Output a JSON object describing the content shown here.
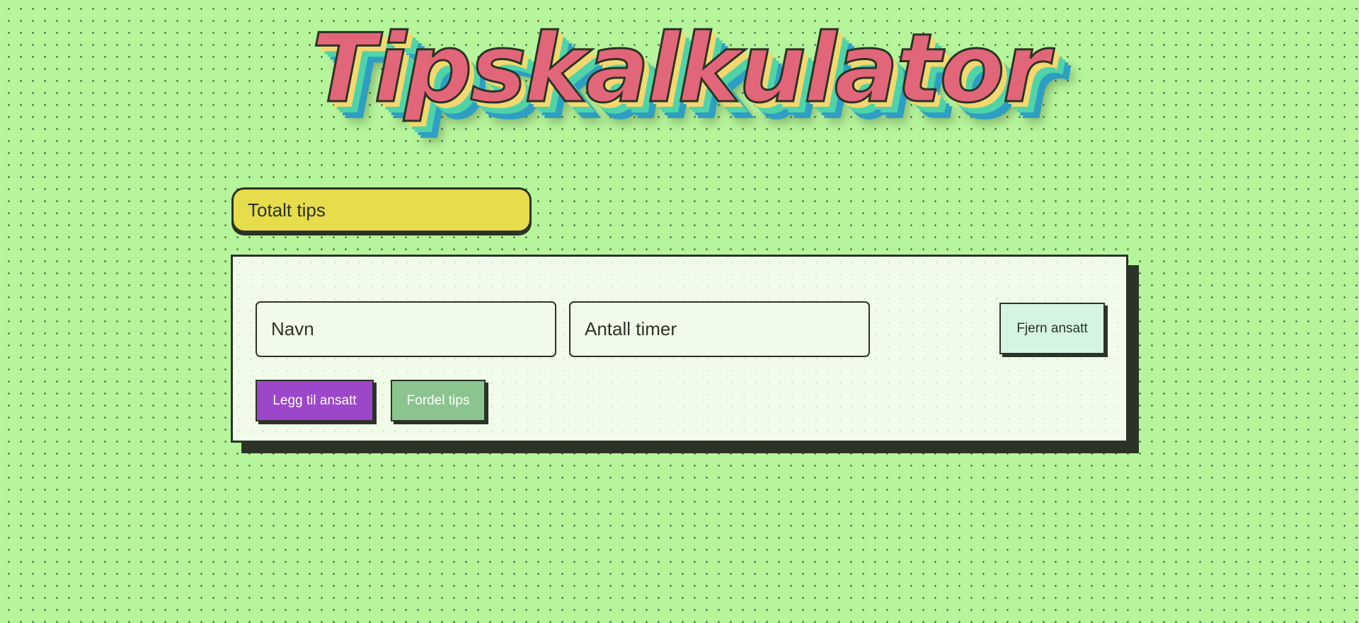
{
  "header": {
    "title": "Tipskalkulator"
  },
  "total_tips": {
    "placeholder": "Totalt tips",
    "value": ""
  },
  "employee_row": {
    "name_placeholder": "Navn",
    "hours_placeholder": "Antall timer",
    "remove_label": "Fjern ansatt"
  },
  "actions": {
    "add_label": "Legg til ansatt",
    "distribute_label": "Fordel tips"
  },
  "colors": {
    "background": "#b6f59b",
    "title_fill": "#e2667a",
    "total_input": "#e7dc4c",
    "card": "#f1fbe9",
    "add_button": "#9c47c9",
    "distribute_button": "#8cc48f",
    "remove_button": "#d5f4e2",
    "outline": "#2b3326"
  }
}
